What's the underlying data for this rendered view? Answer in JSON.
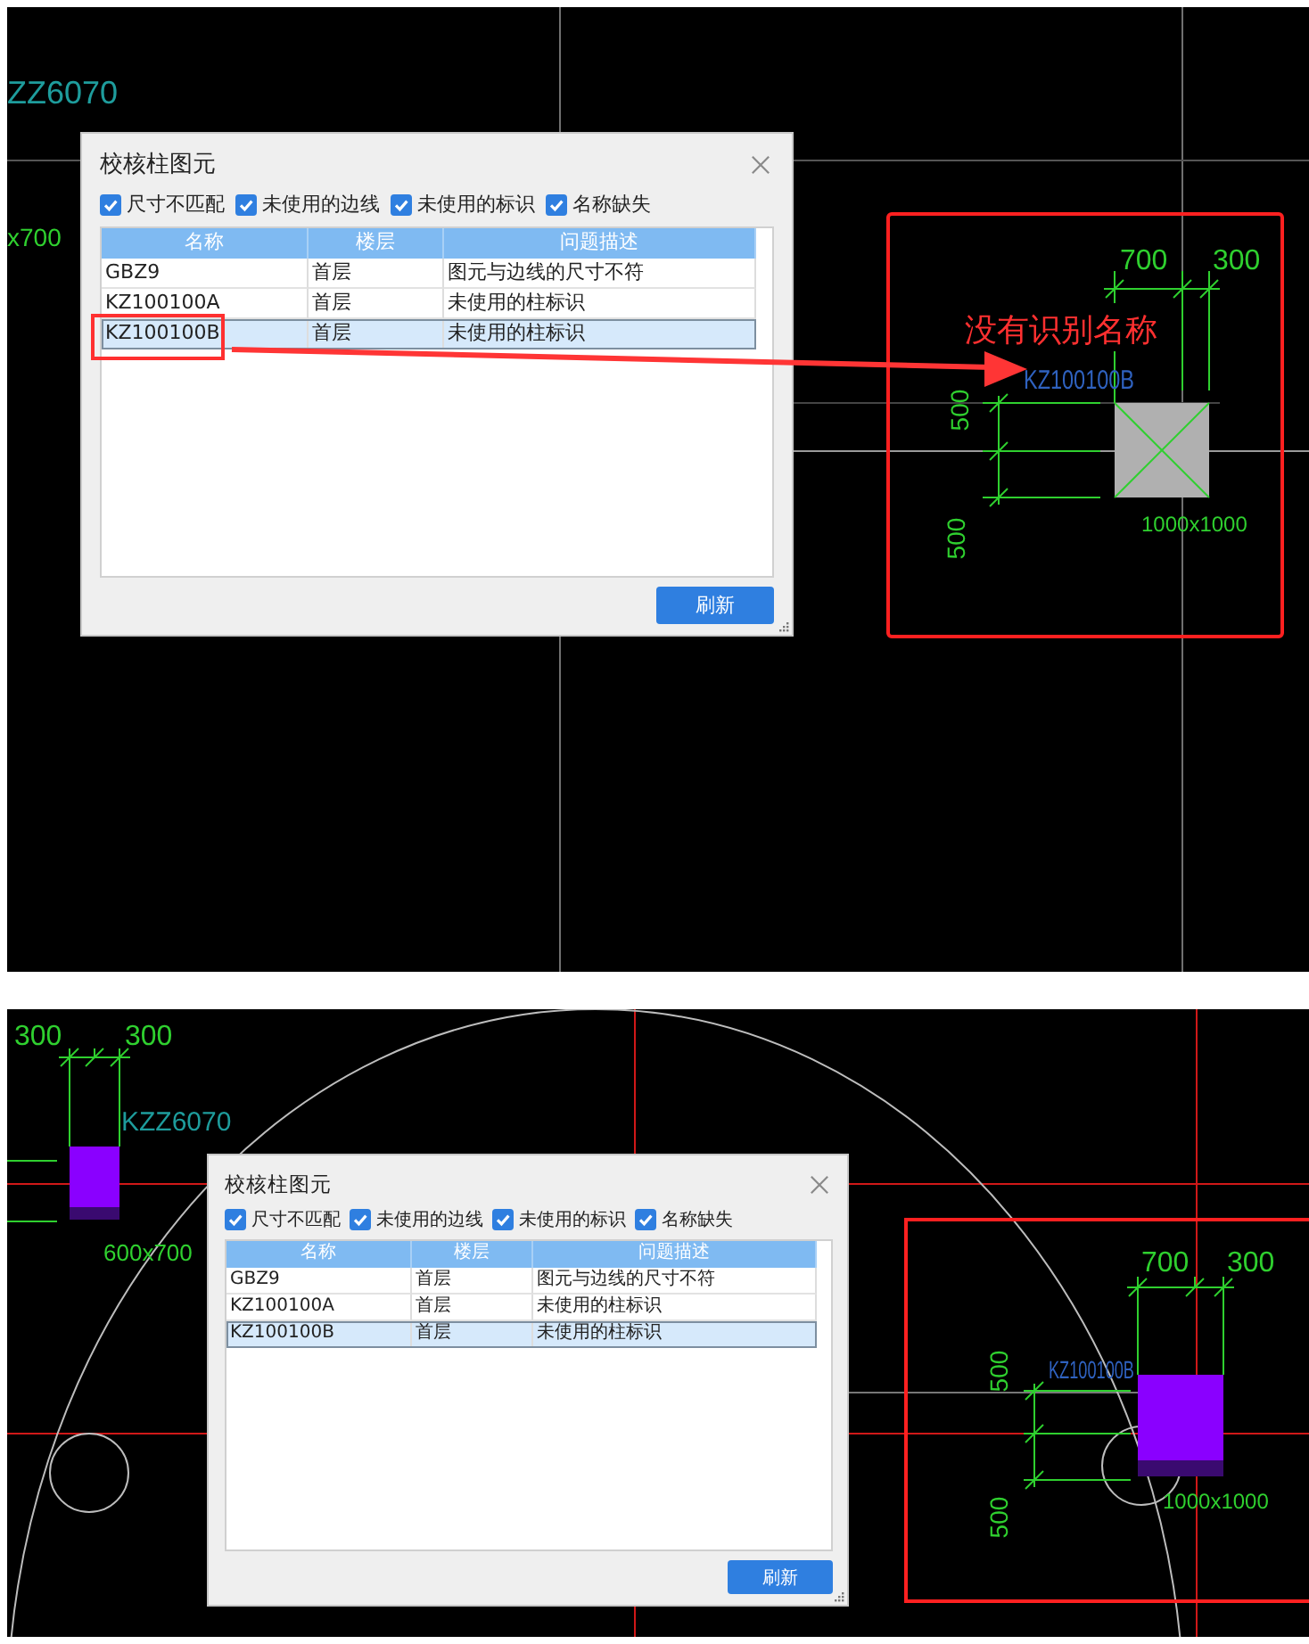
{
  "panels": [
    {
      "kind": "annotated",
      "callout": "没有识别名称",
      "cad_labels": [
        {
          "kind": "type-name",
          "text": "ZZ6070"
        },
        {
          "kind": "dimension",
          "text": "x700"
        },
        {
          "kind": "dimension",
          "text": "700"
        },
        {
          "kind": "dimension",
          "text": "300"
        },
        {
          "kind": "element-name",
          "text": "KZ100100B"
        },
        {
          "kind": "dimension",
          "text": "500"
        },
        {
          "kind": "dimension",
          "text": "500"
        },
        {
          "kind": "dimension",
          "text": "1000x1000"
        }
      ],
      "dialog": {
        "title": "校核柱图元",
        "filters": [
          {
            "label": "尺寸不匹配",
            "checked": true
          },
          {
            "label": "未使用的边线",
            "checked": true
          },
          {
            "label": "未使用的标识",
            "checked": true
          },
          {
            "label": "名称缺失",
            "checked": true
          }
        ],
        "columns": [
          "名称",
          "楼层",
          "问题描述"
        ],
        "rows": [
          {
            "cells": [
              "GBZ9",
              "首层",
              "图元与边线的尺寸不符"
            ],
            "selected": false
          },
          {
            "cells": [
              "KZ100100A",
              "首层",
              "未使用的柱标识"
            ],
            "selected": false
          },
          {
            "cells": [
              "KZ100100B",
              "首层",
              "未使用的柱标识"
            ],
            "selected": true
          }
        ],
        "button": "刷新"
      }
    },
    {
      "kind": "plain",
      "cad_labels": [
        {
          "kind": "dimension",
          "text": "300"
        },
        {
          "kind": "dimension",
          "text": "300"
        },
        {
          "kind": "type-name",
          "text": "KZZ6070"
        },
        {
          "kind": "dimension",
          "text": "600x700"
        },
        {
          "kind": "dimension",
          "text": "700"
        },
        {
          "kind": "dimension",
          "text": "300"
        },
        {
          "kind": "element-name",
          "text": "KZ100100B"
        },
        {
          "kind": "dimension",
          "text": "500"
        },
        {
          "kind": "dimension",
          "text": "500"
        },
        {
          "kind": "dimension",
          "text": "1000x1000"
        }
      ],
      "dialog": {
        "title": "校核柱图元",
        "filters": [
          {
            "label": "尺寸不匹配",
            "checked": true
          },
          {
            "label": "未使用的边线",
            "checked": true
          },
          {
            "label": "未使用的标识",
            "checked": true
          },
          {
            "label": "名称缺失",
            "checked": true
          }
        ],
        "columns": [
          "名称",
          "楼层",
          "问题描述"
        ],
        "rows": [
          {
            "cells": [
              "GBZ9",
              "首层",
              "图元与边线的尺寸不符"
            ],
            "selected": false
          },
          {
            "cells": [
              "KZ100100A",
              "首层",
              "未使用的柱标识"
            ],
            "selected": false
          },
          {
            "cells": [
              "KZ100100B",
              "首层",
              "未使用的柱标识"
            ],
            "selected": true
          }
        ],
        "button": "刷新"
      }
    }
  ]
}
